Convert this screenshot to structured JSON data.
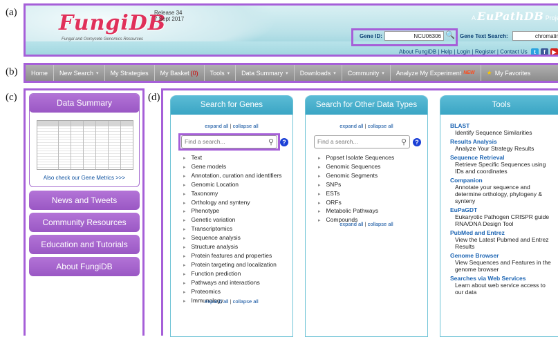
{
  "figure_labels": {
    "a": "(a)",
    "b": "(b)",
    "c": "(c)",
    "d": "(d)"
  },
  "header": {
    "logo": "FungiDB",
    "logo_subtitle": "Fungal and Oomycete Genomics Resources",
    "release": "Release 34",
    "release_date": "7 Sept 2017",
    "eupath_prefix": "A",
    "eupath_name": "EuPathDB",
    "eupath_suffix": "Project",
    "gene_id_label": "Gene ID:",
    "gene_id_value": "NCU06306",
    "gene_text_label": "Gene Text Search:",
    "gene_text_value": "chromatin",
    "top_links": "About FungiDB | Help | Login | Register | Contact Us",
    "social": [
      "twitter-icon",
      "facebook-icon",
      "youtube-icon"
    ]
  },
  "nav": {
    "items": [
      {
        "label": "Home",
        "dropdown": false
      },
      {
        "label": "New Search",
        "dropdown": true
      },
      {
        "label": "My Strategies",
        "dropdown": false
      },
      {
        "label": "My Basket",
        "count": "(0)",
        "dropdown": false
      },
      {
        "label": "Tools",
        "dropdown": true
      },
      {
        "label": "Data Summary",
        "dropdown": true
      },
      {
        "label": "Downloads",
        "dropdown": true
      },
      {
        "label": "Community",
        "dropdown": true
      },
      {
        "label": "Analyze My Experiment",
        "badge": "NEW",
        "dropdown": false
      },
      {
        "label": "My Favorites",
        "star": true,
        "dropdown": false
      }
    ],
    "dropdown_glyph": "▾"
  },
  "sidebar": {
    "data_summary": "Data Summary",
    "metrics_link": "Also check our Gene Metrics >>>",
    "buttons": [
      "News and Tweets",
      "Community Resources",
      "Education and Tutorials",
      "About FungiDB"
    ]
  },
  "main": {
    "expand_all": "expand all",
    "separator": "|",
    "collapse_all": "collapse all",
    "search_placeholder": "Find a search...",
    "genes": {
      "title": "Search for Genes",
      "items": [
        "Text",
        "Gene models",
        "Annotation, curation and identifiers",
        "Genomic Location",
        "Taxonomy",
        "Orthology and synteny",
        "Phenotype",
        "Genetic variation",
        "Transcriptomics",
        "Sequence analysis",
        "Structure analysis",
        "Protein features and properties",
        "Protein targeting and localization",
        "Function prediction",
        "Pathways and interactions",
        "Proteomics",
        "Immunology"
      ]
    },
    "other": {
      "title": "Search for Other Data Types",
      "items": [
        "Popset Isolate Sequences",
        "Genomic Sequences",
        "Genomic Segments",
        "SNPs",
        "ESTs",
        "ORFs",
        "Metabolic Pathways",
        "Compounds"
      ]
    },
    "tools": {
      "title": "Tools",
      "items": [
        {
          "title": "BLAST",
          "desc": "Identify Sequence Similarities"
        },
        {
          "title": "Results Analysis",
          "desc": "Analyze Your Strategy Results"
        },
        {
          "title": "Sequence Retrieval",
          "desc": "Retrieve Specific Sequences using IDs and coordinates"
        },
        {
          "title": "Companion",
          "desc": "Annotate your sequence and determine orthology, phylogeny & synteny"
        },
        {
          "title": "EuPaGDT",
          "desc": "Eukaryotic Pathogen CRISPR guide RNA/DNA Design Tool"
        },
        {
          "title": "PubMed and Entrez",
          "desc": "View the Latest Pubmed and Entrez Results"
        },
        {
          "title": "Genome Browser",
          "desc": "View Sequences and Features in the genome browser"
        },
        {
          "title": "Searches via Web Services",
          "desc": "Learn about web service access to our data"
        }
      ]
    }
  }
}
